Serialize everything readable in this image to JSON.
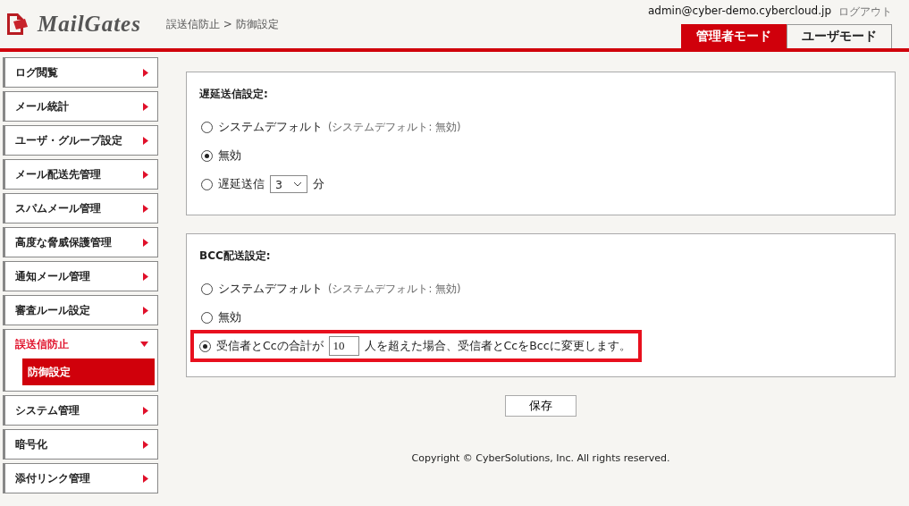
{
  "header": {
    "logo": "MailGates",
    "breadcrumb": "誤送信防止 > 防御設定",
    "user": "admin@cyber-demo.cybercloud.jp",
    "logout": "ログアウト",
    "modes": [
      {
        "label": "管理者モード",
        "selected": true
      },
      {
        "label": "ユーザモード",
        "selected": false
      }
    ]
  },
  "sidebar": {
    "items": [
      {
        "label": "ログ閲覧",
        "expanded": false
      },
      {
        "label": "メール統計",
        "expanded": false
      },
      {
        "label": "ユーザ・グループ設定",
        "expanded": false
      },
      {
        "label": "メール配送先管理",
        "expanded": false
      },
      {
        "label": "スパムメール管理",
        "expanded": false
      },
      {
        "label": "高度な脅威保護管理",
        "expanded": false
      },
      {
        "label": "通知メール管理",
        "expanded": false
      },
      {
        "label": "審査ルール設定",
        "expanded": false
      },
      {
        "label": "誤送信防止",
        "expanded": true,
        "children": [
          {
            "label": "防御設定",
            "selected": true
          }
        ]
      },
      {
        "label": "システム管理",
        "expanded": false
      },
      {
        "label": "暗号化",
        "expanded": false
      },
      {
        "label": "添付リンク管理",
        "expanded": false
      }
    ]
  },
  "sections": [
    {
      "title": "遅延送信設定:",
      "options": [
        {
          "kind": "default",
          "label": "システムデフォルト",
          "note": "(システムデフォルト: 無効)",
          "selected": false,
          "highlighted": false
        },
        {
          "kind": "plain",
          "label": "無効",
          "selected": true,
          "highlighted": false
        },
        {
          "kind": "delay",
          "label": "遅延送信",
          "value": "3",
          "unit": "分",
          "selected": false,
          "highlighted": false
        }
      ]
    },
    {
      "title": "BCC配送設定:",
      "options": [
        {
          "kind": "default",
          "label": "システムデフォルト",
          "note": "(システムデフォルト: 無効)",
          "selected": false,
          "highlighted": false
        },
        {
          "kind": "plain",
          "label": "無効",
          "selected": false,
          "highlighted": false
        },
        {
          "kind": "threshold",
          "before": "受信者とCcの合計が",
          "value": "10",
          "after": "人を超えた場合、受信者とCcをBccに変更します。",
          "selected": true,
          "highlighted": true
        }
      ]
    }
  ],
  "save_button": "保存",
  "copyright": "Copyright © CyberSolutions, Inc. All rights reserved."
}
